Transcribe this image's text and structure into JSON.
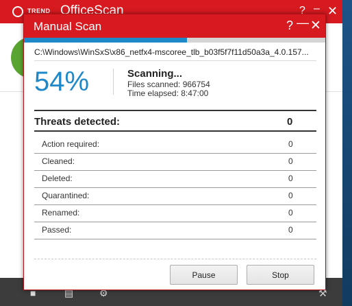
{
  "background_app": {
    "brand": "TREND",
    "product": "OfficeScan",
    "help_glyph": "?",
    "minimize_glyph": "–",
    "close_glyph": "✕",
    "accent": "#d71920"
  },
  "dialog": {
    "title": "Manual Scan",
    "help_glyph": "?",
    "minimize_glyph": "—",
    "close_glyph": "✕",
    "progress": 0.54,
    "progress_color": "#1e88c8",
    "current_path": "C:\\Windows\\WinSxS\\x86_netfx4-mscoree_tlb_b03f5f7f11d50a3a_4.0.157...",
    "percent": "54%",
    "status": "Scanning...",
    "files_scanned": "Files scanned: 966754",
    "time_elapsed": "Time elapsed: 8:47:00",
    "threats_label": "Threats detected:",
    "threats_count": "0",
    "stats": [
      {
        "label": "Action required:",
        "value": "0"
      },
      {
        "label": "Cleaned:",
        "value": "0"
      },
      {
        "label": "Deleted:",
        "value": "0"
      },
      {
        "label": "Quarantined:",
        "value": "0"
      },
      {
        "label": "Renamed:",
        "value": "0"
      },
      {
        "label": "Passed:",
        "value": "0"
      }
    ],
    "pause_label": "Pause",
    "stop_label": "Stop"
  }
}
